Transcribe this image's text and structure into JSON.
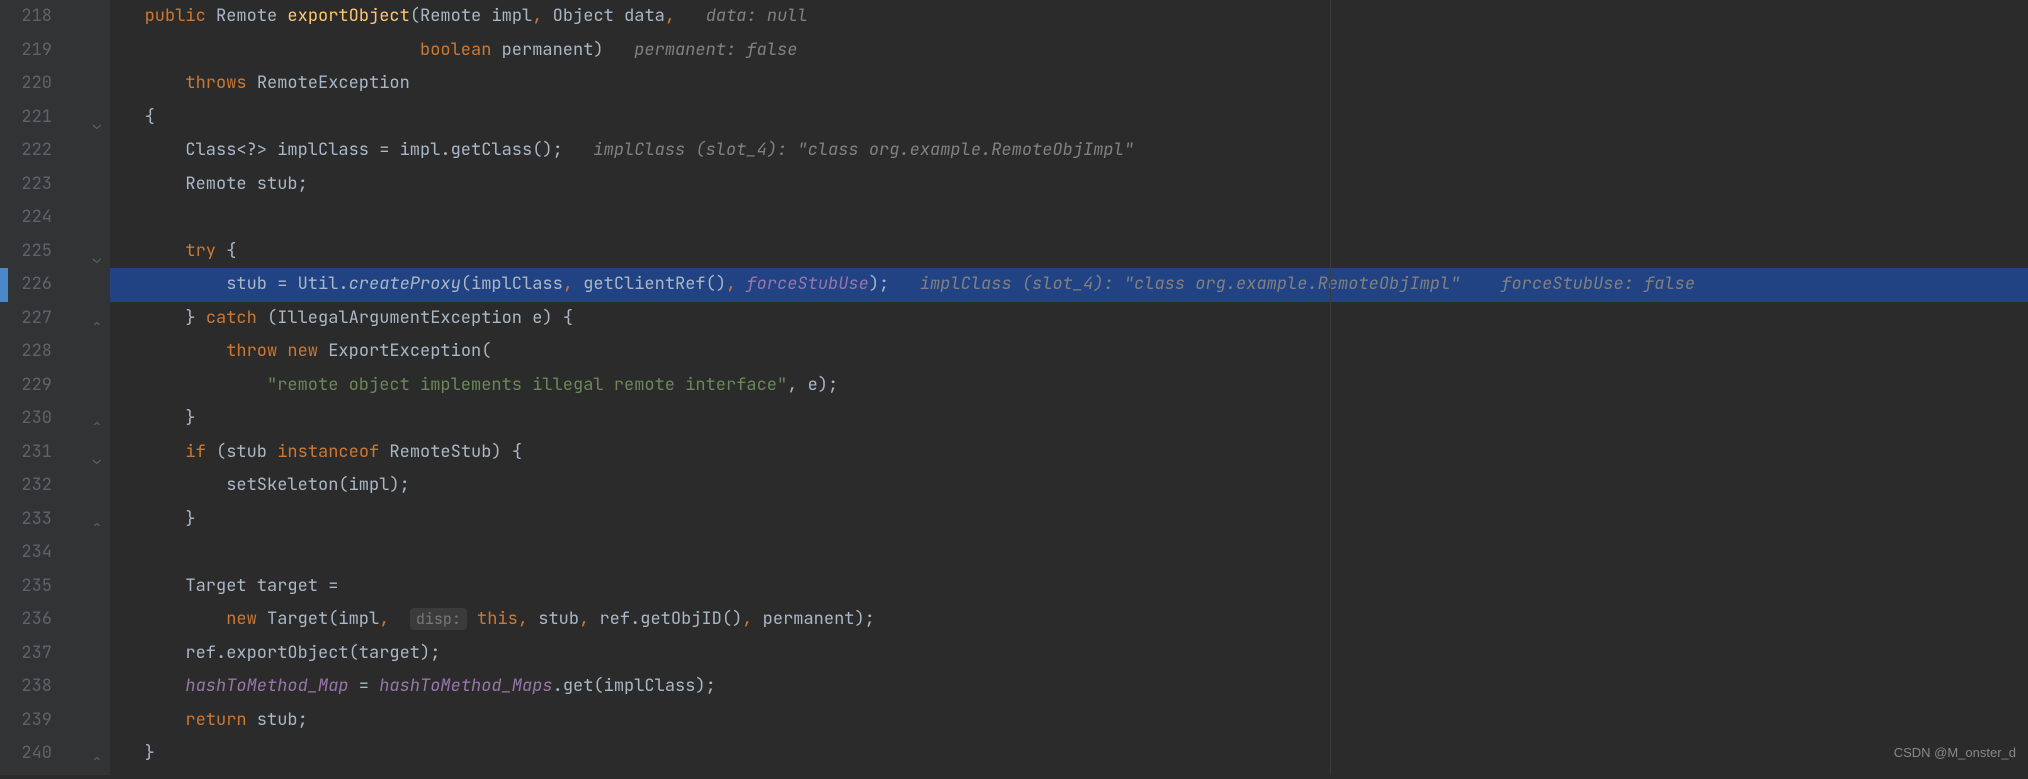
{
  "gutter": {
    "start": 218,
    "end": 240
  },
  "highlighted_line": 226,
  "folds": [
    {
      "line": 221,
      "type": "open"
    },
    {
      "line": 225,
      "type": "open"
    },
    {
      "line": 227,
      "type": "close"
    },
    {
      "line": 230,
      "type": "close"
    },
    {
      "line": 231,
      "type": "open"
    },
    {
      "line": 233,
      "type": "close"
    },
    {
      "line": 240,
      "type": "close"
    }
  ],
  "code": {
    "l218": {
      "kw_public": "public",
      "type_remote": "Remote",
      "method": "exportObject",
      "p1_type": "Remote",
      "p1_name": "impl",
      "p2_type": "Object",
      "p2_name": "data",
      "hint": "data: null"
    },
    "l219": {
      "p3_type": "boolean",
      "p3_name": "permanent",
      "hint": "permanent: false"
    },
    "l220": {
      "kw_throws": "throws",
      "exc": "RemoteException"
    },
    "l221": {
      "brace": "{"
    },
    "l222": {
      "decl": "Class<?> implClass = impl.getClass();",
      "hint": "implClass (slot_4): \"class org.example.RemoteObjImpl\""
    },
    "l223": {
      "decl": "Remote stub;"
    },
    "l225": {
      "kw_try": "try",
      "brace": " {"
    },
    "l226": {
      "lhs": "stub = Util.",
      "method_ital": "createProxy",
      "args1": "(implClass",
      "args2": " getClientRef()",
      "field": "forceStubUse",
      "close": ");",
      "hint1": "implClass (slot_4): \"class org.example.RemoteObjImpl\"",
      "hint2": "forceStubUse: false"
    },
    "l227": {
      "brace": "}",
      "kw_catch": "catch",
      "args": " (IllegalArgumentException e) {"
    },
    "l228": {
      "kw_throw": "throw",
      "kw_new": "new",
      "rest": " ExportException("
    },
    "l229": {
      "str": "\"remote object implements illegal remote interface\"",
      "rest": ", e);"
    },
    "l230": {
      "brace": "}"
    },
    "l231": {
      "kw_if": "if",
      "cond1": " (stub ",
      "kw_inst": "instanceof",
      "cond2": " RemoteStub) {"
    },
    "l232": {
      "call": "setSkeleton(impl);"
    },
    "l233": {
      "brace": "}"
    },
    "l235": {
      "decl": "Target target ="
    },
    "l236": {
      "kw_new": "new",
      "t1": " Target(impl",
      "hint_label": "disp:",
      "kw_this": "this",
      "t2": " stub",
      "t3": " ref.getObjID()",
      "t4": " permanent);"
    },
    "l237": {
      "call": "ref.exportObject(target);"
    },
    "l238": {
      "field1": "hashToMethod_Map",
      "eq": " = ",
      "field2": "hashToMethod_Maps",
      "rest": ".get(implClass);"
    },
    "l239": {
      "kw_return": "return",
      "rest": " stub;"
    },
    "l240": {
      "brace": "}"
    }
  },
  "watermark": "CSDN @M_onster_d"
}
